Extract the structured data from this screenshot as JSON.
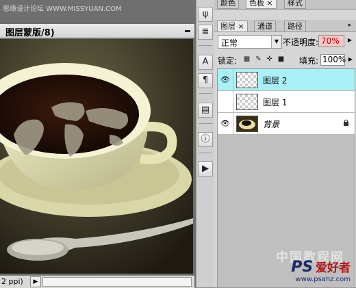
{
  "watermark_top": "思缘设计论坛 WWW.MISSYUAN.COM",
  "document": {
    "title": "图层蒙版/8)",
    "status_text": "2 ppi)",
    "status_arrow": "▶"
  },
  "tools": [
    {
      "name": "brush-tool-icon",
      "glyph": "ψ"
    },
    {
      "name": "stamp-tool-icon",
      "glyph": "≣"
    },
    {
      "name": "character-panel-icon",
      "glyph": "A"
    },
    {
      "name": "paragraph-panel-icon",
      "glyph": "¶"
    },
    {
      "name": "notes-panel-icon",
      "glyph": "▤"
    },
    {
      "name": "info-panel-icon",
      "glyph": "ⓘ"
    },
    {
      "name": "actions-panel-icon",
      "glyph": "▶"
    }
  ],
  "panel": {
    "top_tabs": [
      "颜色",
      "色板",
      "样式"
    ],
    "top_tab_close": "×",
    "tabs": [
      "图层",
      "通道",
      "路径"
    ],
    "tab_close": "×",
    "menu_glyph": "▸",
    "blend_mode": "正常",
    "opacity_label": "不透明度:",
    "opacity_value": "70%",
    "lock_label": "锁定:",
    "fill_label": "填充:",
    "fill_value": "100%",
    "layers": [
      {
        "name": "图层 2",
        "visible": true,
        "selected": true
      },
      {
        "name": "图层 1",
        "visible": false,
        "selected": false
      },
      {
        "name": "背景",
        "visible": true,
        "selected": false,
        "locked": true
      }
    ]
  },
  "watermark_bottom": {
    "ps": "PS",
    "text": "爱好者",
    "url": "www.psahz.com",
    "faint": "中国教程网"
  },
  "colors": {
    "selected_layer": "#a9f0f7",
    "opacity_field": "#ffc8c8"
  }
}
